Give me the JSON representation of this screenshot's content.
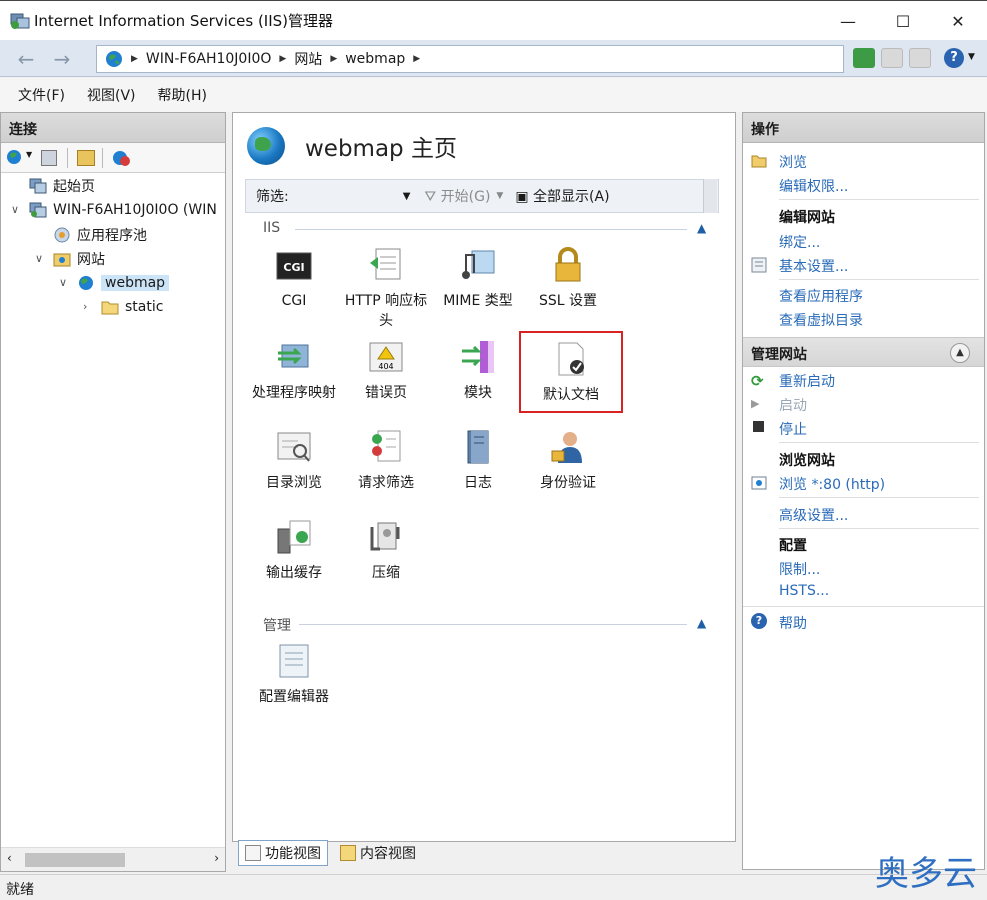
{
  "window": {
    "title": "Internet Information Services (IIS)管理器",
    "minimize": "—",
    "maximize": "☐",
    "close": "✕"
  },
  "address": {
    "crumbs": [
      "WIN-F6AH10J0I0O",
      "网站",
      "webmap"
    ]
  },
  "menu": [
    "文件(F)",
    "视图(V)",
    "帮助(H)"
  ],
  "connections": {
    "title": "连接",
    "tree": [
      {
        "label": "起始页"
      },
      {
        "label": "WIN-F6AH10J0I0O (WIN"
      },
      {
        "label": "应用程序池"
      },
      {
        "label": "网站"
      },
      {
        "label": "webmap"
      },
      {
        "label": "static"
      }
    ]
  },
  "page": {
    "title": "webmap 主页",
    "filter": {
      "label": "筛选:",
      "start": "开始(G)",
      "show_all": "全部显示(A)"
    },
    "groups": {
      "iis": "IIS",
      "manage": "管理"
    },
    "features": [
      {
        "label": "CGI"
      },
      {
        "label": "HTTP 响应标头"
      },
      {
        "label": "MIME 类型"
      },
      {
        "label": "SSL 设置"
      },
      {
        "label": "处理程序映射"
      },
      {
        "label": "错误页"
      },
      {
        "label": "模块"
      },
      {
        "label": "默认文档"
      },
      {
        "label": "目录浏览"
      },
      {
        "label": "请求筛选"
      },
      {
        "label": "日志"
      },
      {
        "label": "身份验证"
      },
      {
        "label": "输出缓存"
      },
      {
        "label": "压缩"
      },
      {
        "label": "配置编辑器"
      }
    ],
    "tabs": {
      "features": "功能视图",
      "content": "内容视图"
    }
  },
  "actions": {
    "title": "操作",
    "browse": "浏览",
    "edit_perms": "编辑权限...",
    "edit_site": "编辑网站",
    "bindings": "绑定...",
    "basic_settings": "基本设置...",
    "view_apps": "查看应用程序",
    "view_vdirs": "查看虚拟目录",
    "manage_site": "管理网站",
    "restart": "重新启动",
    "start": "启动",
    "stop": "停止",
    "browse_site": "浏览网站",
    "browse_http": "浏览 *:80 (http)",
    "advanced": "高级设置...",
    "config": "配置",
    "limits": "限制...",
    "hsts": "HSTS...",
    "help": "帮助"
  },
  "status": "就绪",
  "watermark": "奥多云"
}
